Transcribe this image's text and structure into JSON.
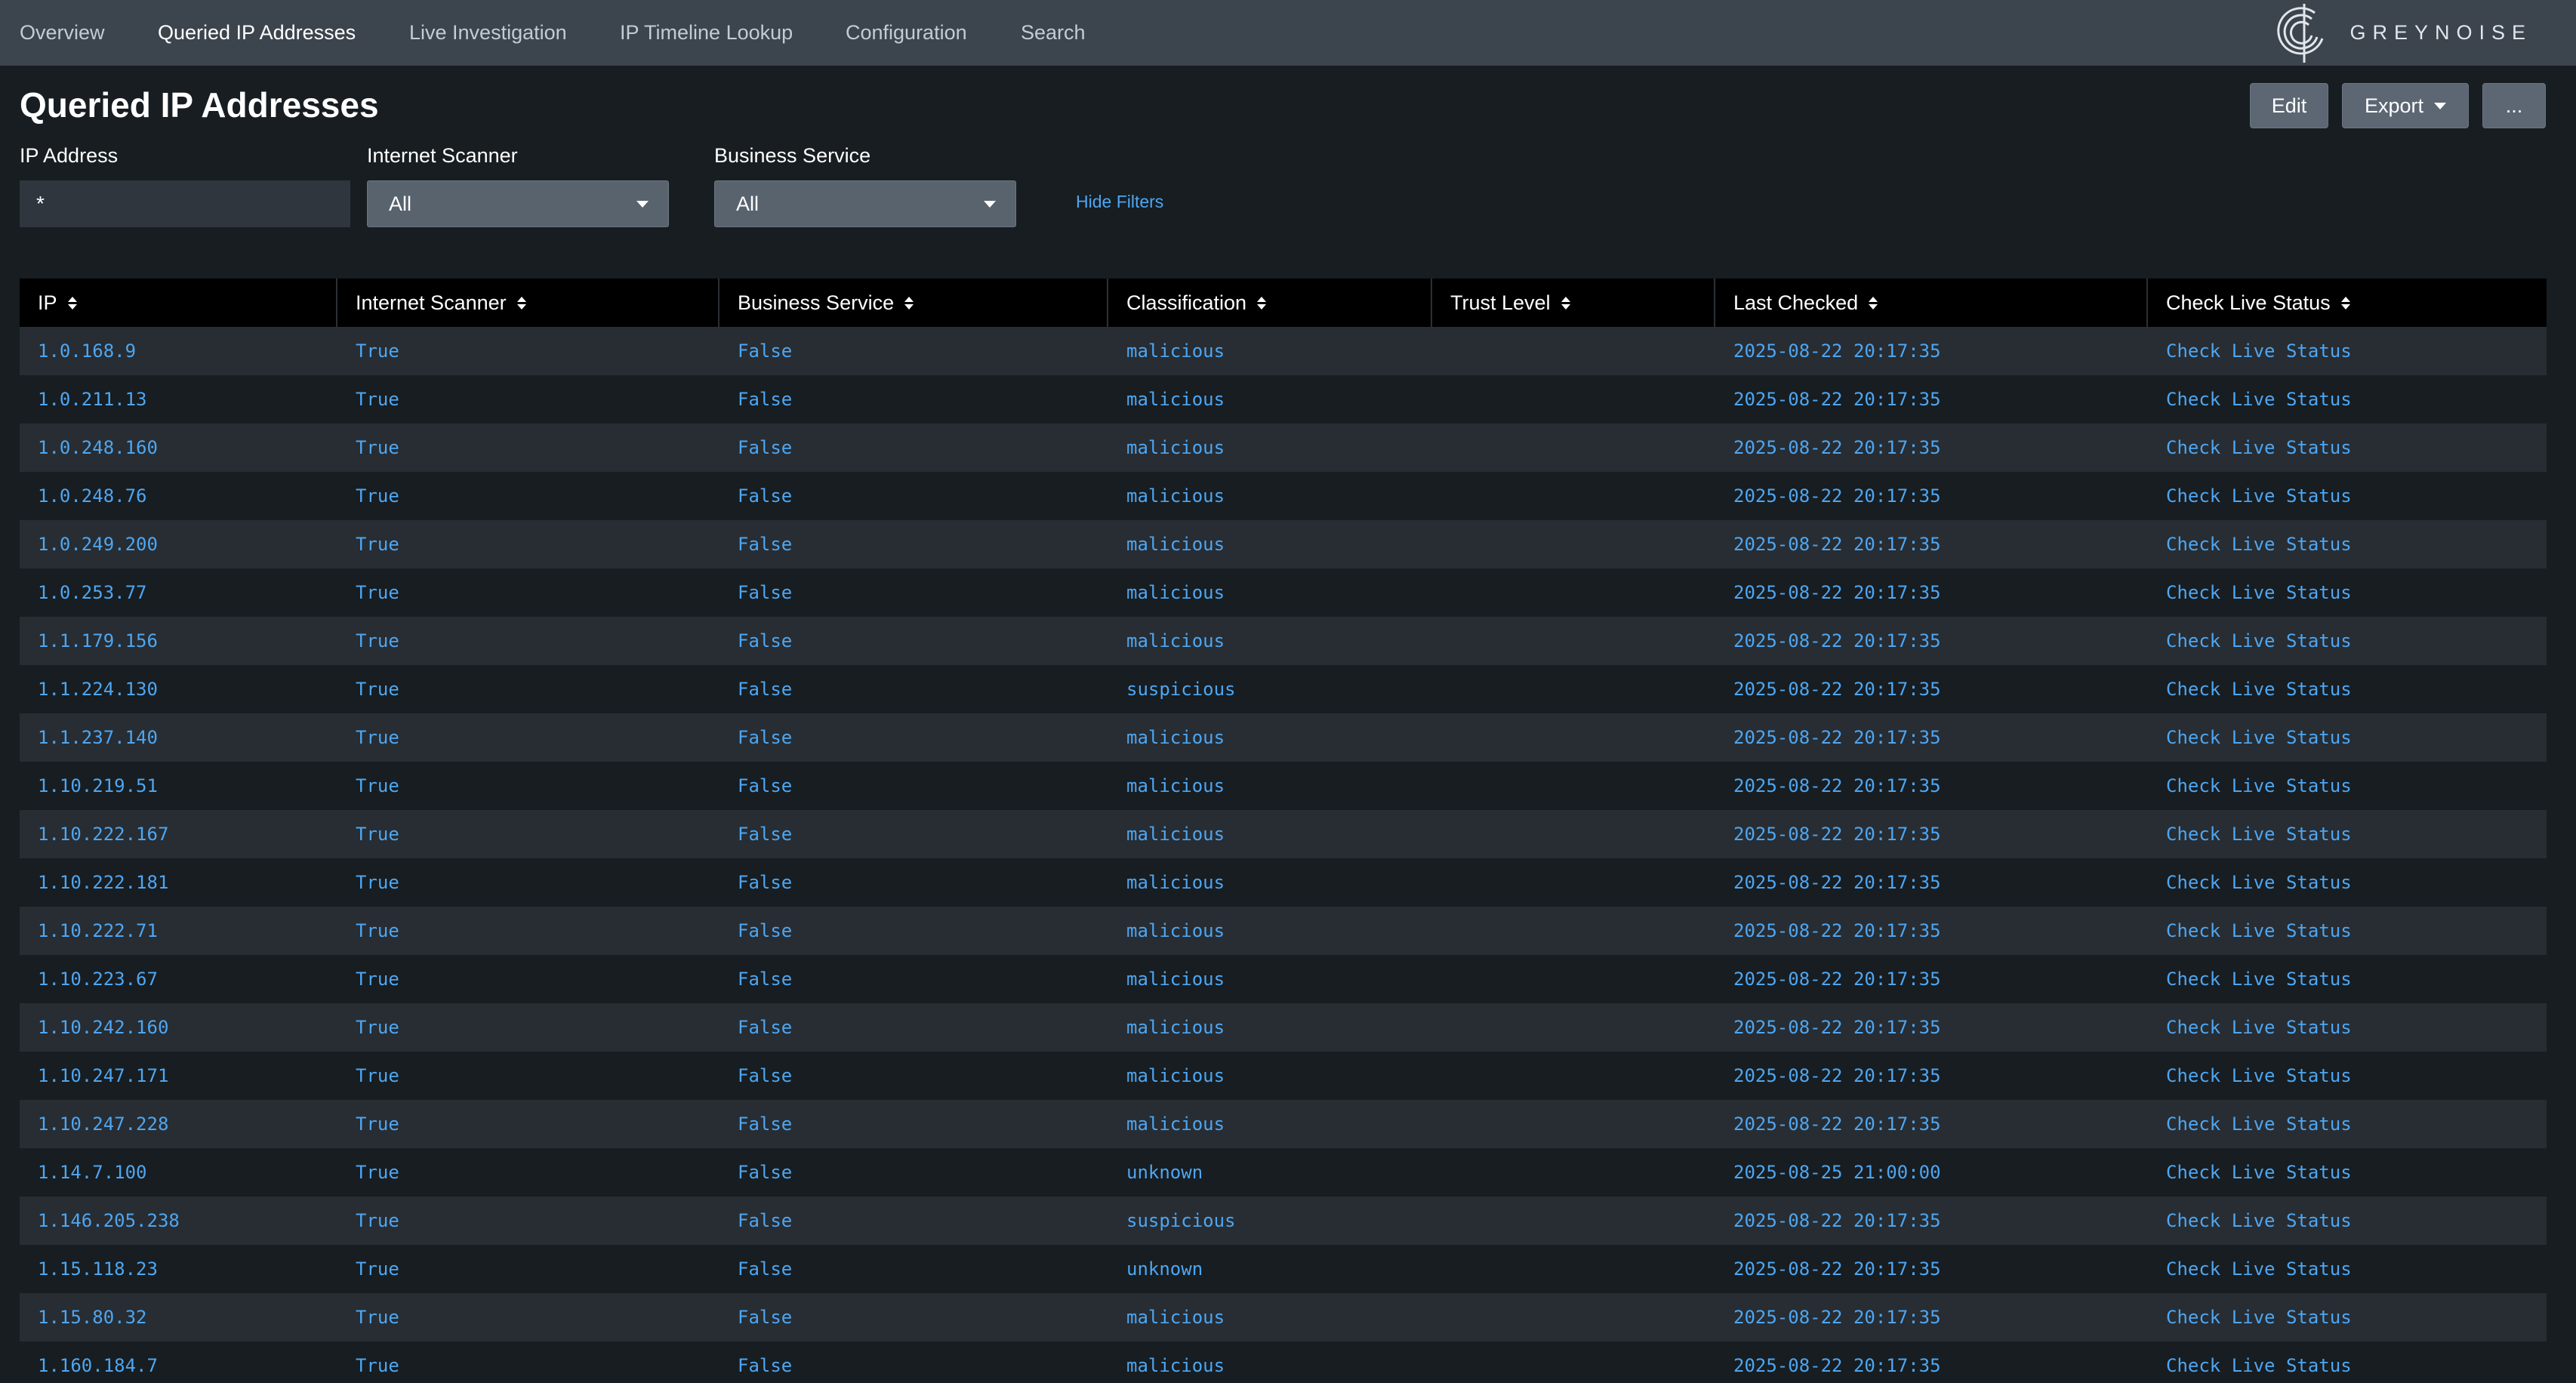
{
  "nav": {
    "items": [
      {
        "label": "Overview",
        "active": false
      },
      {
        "label": "Queried IP Addresses",
        "active": true
      },
      {
        "label": "Live Investigation",
        "active": false
      },
      {
        "label": "IP Timeline Lookup",
        "active": false
      },
      {
        "label": "Configuration",
        "active": false
      },
      {
        "label": "Search",
        "active": false
      }
    ],
    "logo_text": "GREYNOISE"
  },
  "page": {
    "title": "Queried IP Addresses",
    "actions": {
      "edit": "Edit",
      "export": "Export",
      "more": "..."
    }
  },
  "filters": {
    "ip": {
      "label": "IP Address",
      "value": "*"
    },
    "scanner": {
      "label": "Internet Scanner",
      "value": "All"
    },
    "business": {
      "label": "Business Service",
      "value": "All"
    },
    "hide": "Hide Filters"
  },
  "table": {
    "columns": [
      "IP",
      "Internet Scanner",
      "Business Service",
      "Classification",
      "Trust Level",
      "Last Checked",
      "Check Live Status"
    ],
    "rows": [
      {
        "ip": "1.0.168.9",
        "scanner": "True",
        "business": "False",
        "classification": "malicious",
        "trust": "",
        "checked": "2025-08-22 20:17:35",
        "action": "Check Live Status"
      },
      {
        "ip": "1.0.211.13",
        "scanner": "True",
        "business": "False",
        "classification": "malicious",
        "trust": "",
        "checked": "2025-08-22 20:17:35",
        "action": "Check Live Status"
      },
      {
        "ip": "1.0.248.160",
        "scanner": "True",
        "business": "False",
        "classification": "malicious",
        "trust": "",
        "checked": "2025-08-22 20:17:35",
        "action": "Check Live Status"
      },
      {
        "ip": "1.0.248.76",
        "scanner": "True",
        "business": "False",
        "classification": "malicious",
        "trust": "",
        "checked": "2025-08-22 20:17:35",
        "action": "Check Live Status"
      },
      {
        "ip": "1.0.249.200",
        "scanner": "True",
        "business": "False",
        "classification": "malicious",
        "trust": "",
        "checked": "2025-08-22 20:17:35",
        "action": "Check Live Status"
      },
      {
        "ip": "1.0.253.77",
        "scanner": "True",
        "business": "False",
        "classification": "malicious",
        "trust": "",
        "checked": "2025-08-22 20:17:35",
        "action": "Check Live Status"
      },
      {
        "ip": "1.1.179.156",
        "scanner": "True",
        "business": "False",
        "classification": "malicious",
        "trust": "",
        "checked": "2025-08-22 20:17:35",
        "action": "Check Live Status"
      },
      {
        "ip": "1.1.224.130",
        "scanner": "True",
        "business": "False",
        "classification": "suspicious",
        "trust": "",
        "checked": "2025-08-22 20:17:35",
        "action": "Check Live Status"
      },
      {
        "ip": "1.1.237.140",
        "scanner": "True",
        "business": "False",
        "classification": "malicious",
        "trust": "",
        "checked": "2025-08-22 20:17:35",
        "action": "Check Live Status"
      },
      {
        "ip": "1.10.219.51",
        "scanner": "True",
        "business": "False",
        "classification": "malicious",
        "trust": "",
        "checked": "2025-08-22 20:17:35",
        "action": "Check Live Status"
      },
      {
        "ip": "1.10.222.167",
        "scanner": "True",
        "business": "False",
        "classification": "malicious",
        "trust": "",
        "checked": "2025-08-22 20:17:35",
        "action": "Check Live Status"
      },
      {
        "ip": "1.10.222.181",
        "scanner": "True",
        "business": "False",
        "classification": "malicious",
        "trust": "",
        "checked": "2025-08-22 20:17:35",
        "action": "Check Live Status"
      },
      {
        "ip": "1.10.222.71",
        "scanner": "True",
        "business": "False",
        "classification": "malicious",
        "trust": "",
        "checked": "2025-08-22 20:17:35",
        "action": "Check Live Status"
      },
      {
        "ip": "1.10.223.67",
        "scanner": "True",
        "business": "False",
        "classification": "malicious",
        "trust": "",
        "checked": "2025-08-22 20:17:35",
        "action": "Check Live Status"
      },
      {
        "ip": "1.10.242.160",
        "scanner": "True",
        "business": "False",
        "classification": "malicious",
        "trust": "",
        "checked": "2025-08-22 20:17:35",
        "action": "Check Live Status"
      },
      {
        "ip": "1.10.247.171",
        "scanner": "True",
        "business": "False",
        "classification": "malicious",
        "trust": "",
        "checked": "2025-08-22 20:17:35",
        "action": "Check Live Status"
      },
      {
        "ip": "1.10.247.228",
        "scanner": "True",
        "business": "False",
        "classification": "malicious",
        "trust": "",
        "checked": "2025-08-22 20:17:35",
        "action": "Check Live Status"
      },
      {
        "ip": "1.14.7.100",
        "scanner": "True",
        "business": "False",
        "classification": "unknown",
        "trust": "",
        "checked": "2025-08-25 21:00:00",
        "action": "Check Live Status"
      },
      {
        "ip": "1.146.205.238",
        "scanner": "True",
        "business": "False",
        "classification": "suspicious",
        "trust": "",
        "checked": "2025-08-22 20:17:35",
        "action": "Check Live Status"
      },
      {
        "ip": "1.15.118.23",
        "scanner": "True",
        "business": "False",
        "classification": "unknown",
        "trust": "",
        "checked": "2025-08-22 20:17:35",
        "action": "Check Live Status"
      },
      {
        "ip": "1.15.80.32",
        "scanner": "True",
        "business": "False",
        "classification": "malicious",
        "trust": "",
        "checked": "2025-08-22 20:17:35",
        "action": "Check Live Status"
      },
      {
        "ip": "1.160.184.7",
        "scanner": "True",
        "business": "False",
        "classification": "malicious",
        "trust": "",
        "checked": "2025-08-22 20:17:35",
        "action": "Check Live Status"
      }
    ]
  },
  "colors": {
    "nav_bg": "#3c444d",
    "page_bg": "#171d21",
    "row_alt": "#272d33",
    "link": "#4ea6f2"
  }
}
